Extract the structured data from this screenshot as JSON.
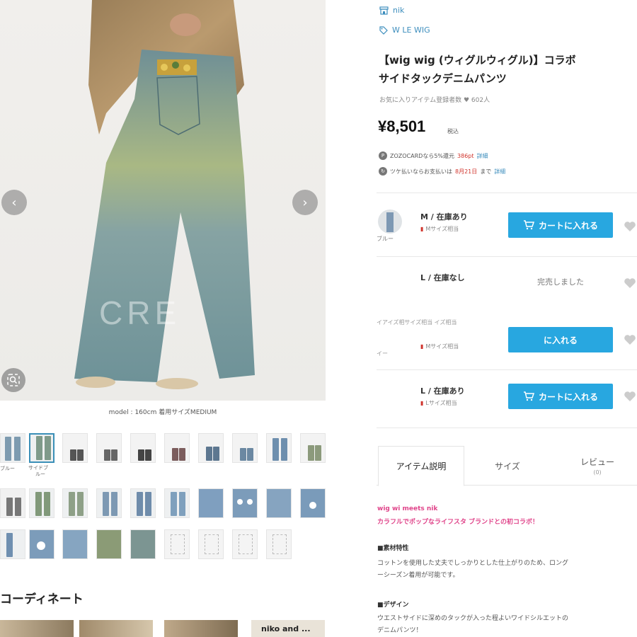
{
  "gallery": {
    "prev_icon": "chevron-left-icon",
    "next_icon": "chevron-right-icon",
    "zoom_icon": "zoom-icon",
    "watermark": "CRE",
    "model_caption": "model : 160cm 着用サイズMEDIUM",
    "thumb_labels": [
      "ブルー",
      "サイドブ",
      "ルー"
    ]
  },
  "coordinate": {
    "heading": "コーディネート",
    "strip_text": "niko and ..."
  },
  "product": {
    "brand": "nik",
    "brand_icon": "shop-icon",
    "tag": "W    LE WIG",
    "tag_icon": "tag-icon",
    "title": "【wig      wig   (ウィグルウィグル)】コラボ\nサイドタックデニムパンツ",
    "favorites": "お気に入りアイテム登録者数 ♥ 602人",
    "price": "¥8,501",
    "tax": "税込",
    "promo1": {
      "icon": "P",
      "text": "ZOZOCARDなら5%還元",
      "highlight": "386pt",
      "link": "詳細"
    },
    "promo2": {
      "icon": "↻",
      "text": "ツケ払いならお支払いは",
      "highlight": "8月21日",
      "tail": "まで",
      "link": "詳細"
    }
  },
  "variants": [
    {
      "color": "ブルー",
      "size": "M / 在庫あり",
      "sub": "Mサイズ相当",
      "action": "カートに入れる",
      "state": "in-stock"
    },
    {
      "color": "",
      "size": "L / 在庫なし",
      "sub": "",
      "action": "完売しました",
      "state": "sold-out"
    },
    {
      "color": "",
      "size": "",
      "sub": "Mサイズ相当",
      "action": "に入れる",
      "state": "in-stock",
      "extra": "イアイズ相サイズ相当   イズ相当",
      "extra2": "イー"
    },
    {
      "color": "",
      "size": "L / 在庫あり",
      "sub": "Lサイズ相当",
      "action": "カートに入れる",
      "state": "in-stock"
    }
  ],
  "tabs": [
    {
      "label": "アイテム説明",
      "count": ""
    },
    {
      "label": "サイズ",
      "count": ""
    },
    {
      "label": "レビュー",
      "count": "(0)"
    }
  ],
  "description": {
    "line1": "wig    wi       meets nik",
    "line2": "カラフルでポップなライフスタ    ブランドとの初コラボ！",
    "material_head": "■素材特性",
    "material_body": "コットンを使用した丈夫でしっかりとした仕上がりのため、ロング\nーシーズン着用が可能です。",
    "design_head": "■デザイン",
    "design_body": "ウエストサイドに深めのタックが入った程よいワイドシルエットの\nデニムパンツ！"
  },
  "colors": {
    "accent": "#28a7e0",
    "link": "#3d8ebd",
    "pink": "#e0448a",
    "red": "#d0342c"
  }
}
